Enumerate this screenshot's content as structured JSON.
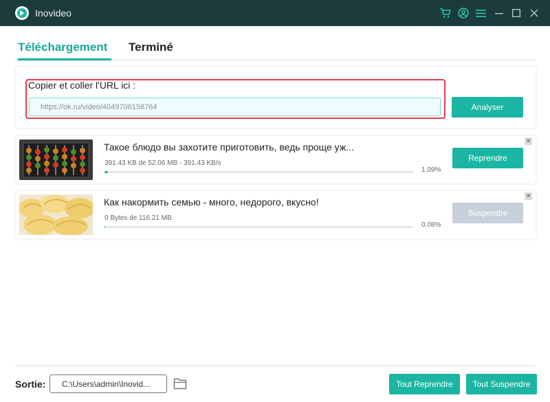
{
  "app": {
    "title": "Inovideo"
  },
  "titlebar": {
    "icons": [
      "cart-icon",
      "account-icon",
      "menu-icon",
      "minimize-icon",
      "maximize-icon",
      "close-icon"
    ]
  },
  "tabs": [
    {
      "label": "Téléchargement",
      "active": true
    },
    {
      "label": "Terminé",
      "active": false
    }
  ],
  "url_section": {
    "label": "Copier et coller l'URL ici :",
    "value": "https://ok.ru/video/4049706158764",
    "analyse_button": "Analyser"
  },
  "downloads": [
    {
      "title": "Такое блюдо вы захотите приготовить, ведь проще уж...",
      "info": "391.43 KB de 52.06 MB - 391.43 KB/s",
      "percent": "1.09%",
      "progress": 0.0109,
      "button": "Reprendre",
      "button_enabled": true
    },
    {
      "title": "Как накормить семью - много, недорого, вкусно!",
      "info": "0 Bytes de 116.21 MB",
      "percent": "0.08%",
      "progress": 0.0008,
      "button": "Suspendre",
      "button_enabled": false
    }
  ],
  "footer": {
    "output_label": "Sortie:",
    "output_path": "C:\\Users\\admin\\Inovid...",
    "resume_all": "Tout Reprendre",
    "suspend_all": "Tout Suspendre"
  },
  "colors": {
    "accent": "#1bb6a3",
    "titlebar": "#1c3b3d",
    "highlight": "#e73c4c",
    "disabled": "#c7d0db"
  }
}
